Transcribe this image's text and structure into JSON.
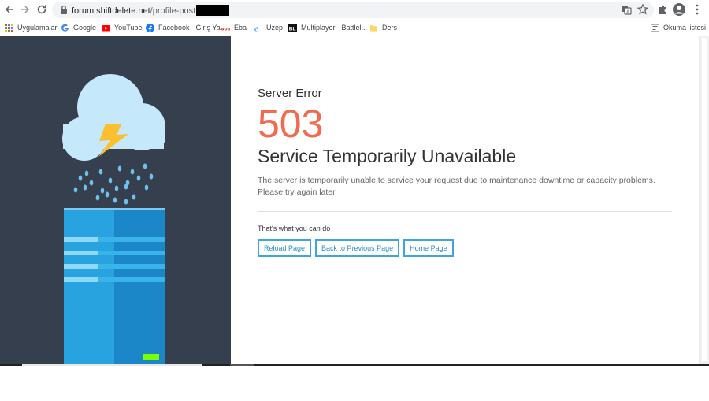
{
  "browser": {
    "url_host": "forum.shiftdelete.net",
    "url_path": "/profile-post"
  },
  "bookmarks": [
    {
      "label": "Uygulamalar",
      "icon": "apps-grid-icon"
    },
    {
      "label": "Google",
      "icon": "google-icon"
    },
    {
      "label": "YouTube",
      "icon": "youtube-icon"
    },
    {
      "label": "Facebook - Giriş Ya...",
      "icon": "facebook-icon"
    },
    {
      "label": "Eba",
      "icon": "eba-icon"
    },
    {
      "label": "Uzep",
      "icon": "edge-icon"
    },
    {
      "label": "Multiplayer - Battlel...",
      "icon": "bl-icon"
    },
    {
      "label": "Ders",
      "icon": "folder-icon"
    }
  ],
  "reading_list": "Okuma listesi",
  "error": {
    "label": "Server Error",
    "code": "503",
    "title": "Service Temporarily Unavailable",
    "description": "The server is temporarily unable to service your request due to maintenance downtime or capacity problems. Please try again later.",
    "subhead": "That's what you can do",
    "buttons": [
      "Reload Page",
      "Back to Previous Page",
      "Home Page"
    ]
  },
  "colors": {
    "panel_bg": "#363f4d",
    "code_color": "#f06c4f",
    "button_border": "#3ea6da",
    "server_light": "#29a3e0",
    "server_dark": "#1b87c9",
    "led": "#7bff00",
    "bolt": "#fbc02d"
  }
}
